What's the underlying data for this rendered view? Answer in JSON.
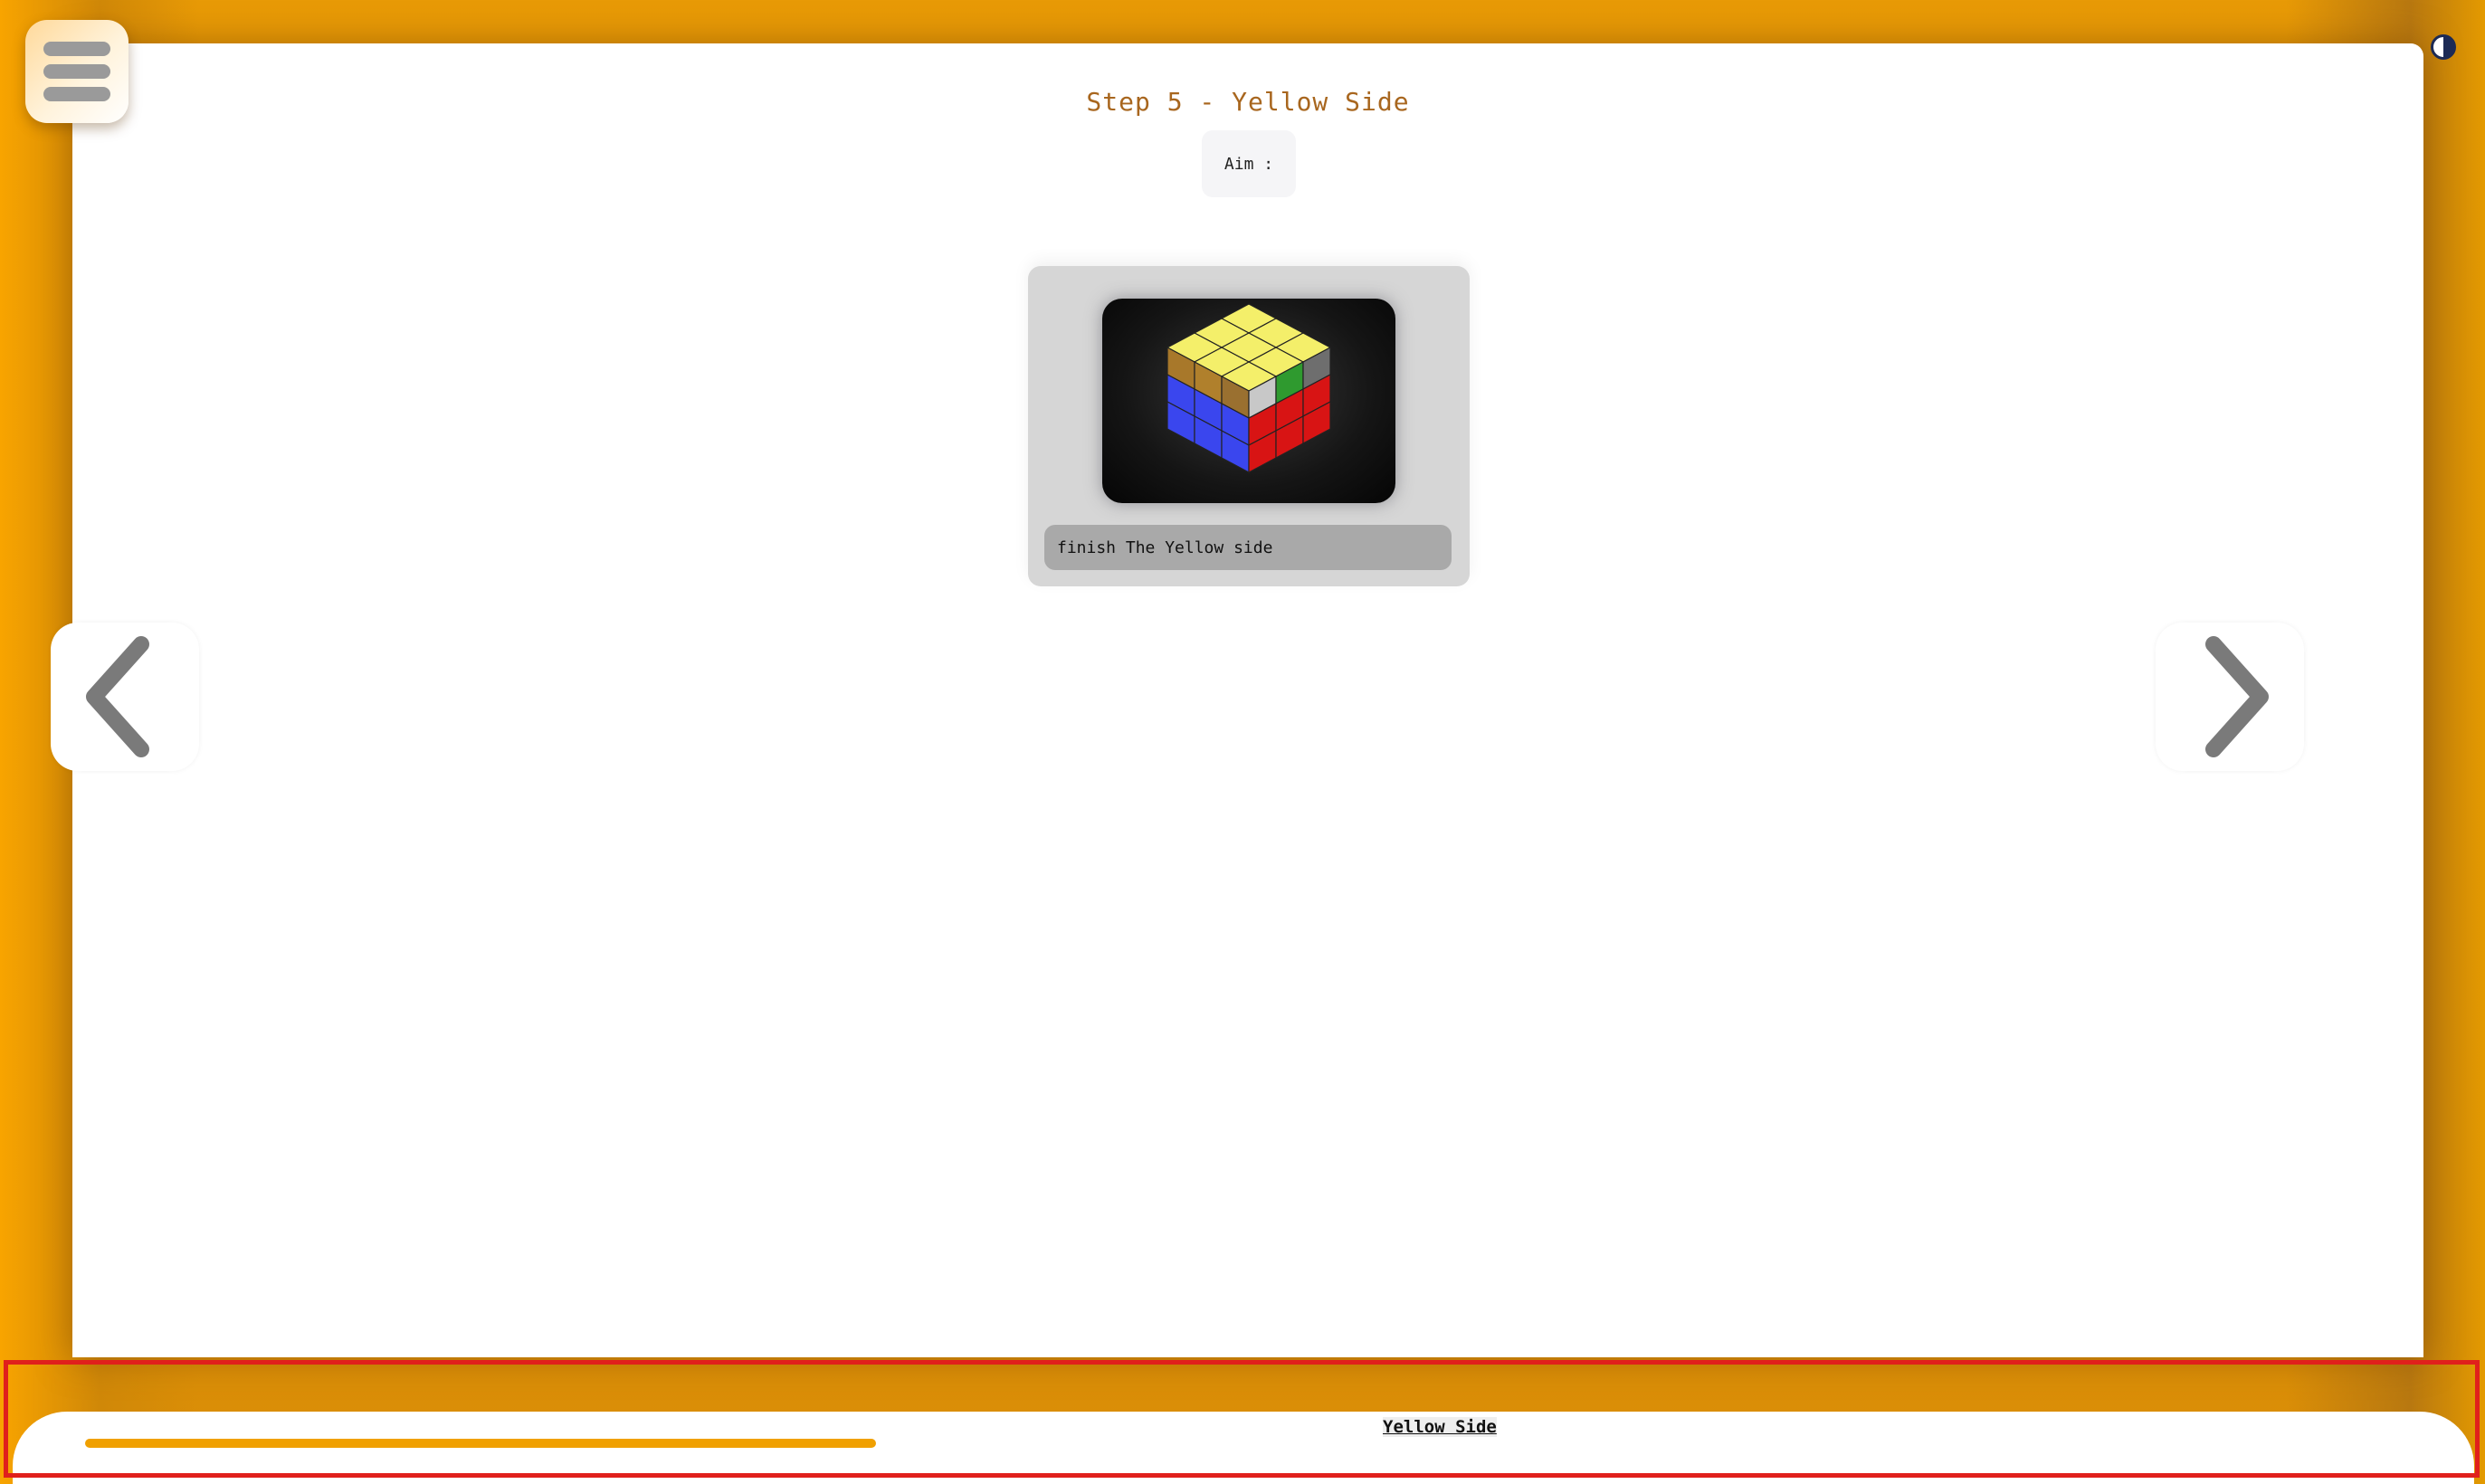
{
  "page": {
    "title": "Step 5 - Yellow Side",
    "aim_label": "Aim :"
  },
  "card": {
    "caption": "finish The Yellow side",
    "image_icon": "rubiks-cube-yellow-side-image"
  },
  "navigation": {
    "menu_icon": "hamburger-menu-icon",
    "theme_icon": "contrast-toggle-icon",
    "prev_icon": "chevron-left-icon",
    "next_icon": "chevron-right-icon"
  },
  "footer": {
    "step_label": "Yellow Side",
    "progress_fraction": 0.56
  },
  "colors": {
    "accent": "#f0a000",
    "title": "#a8661e",
    "highlight_border": "#e0201c"
  }
}
